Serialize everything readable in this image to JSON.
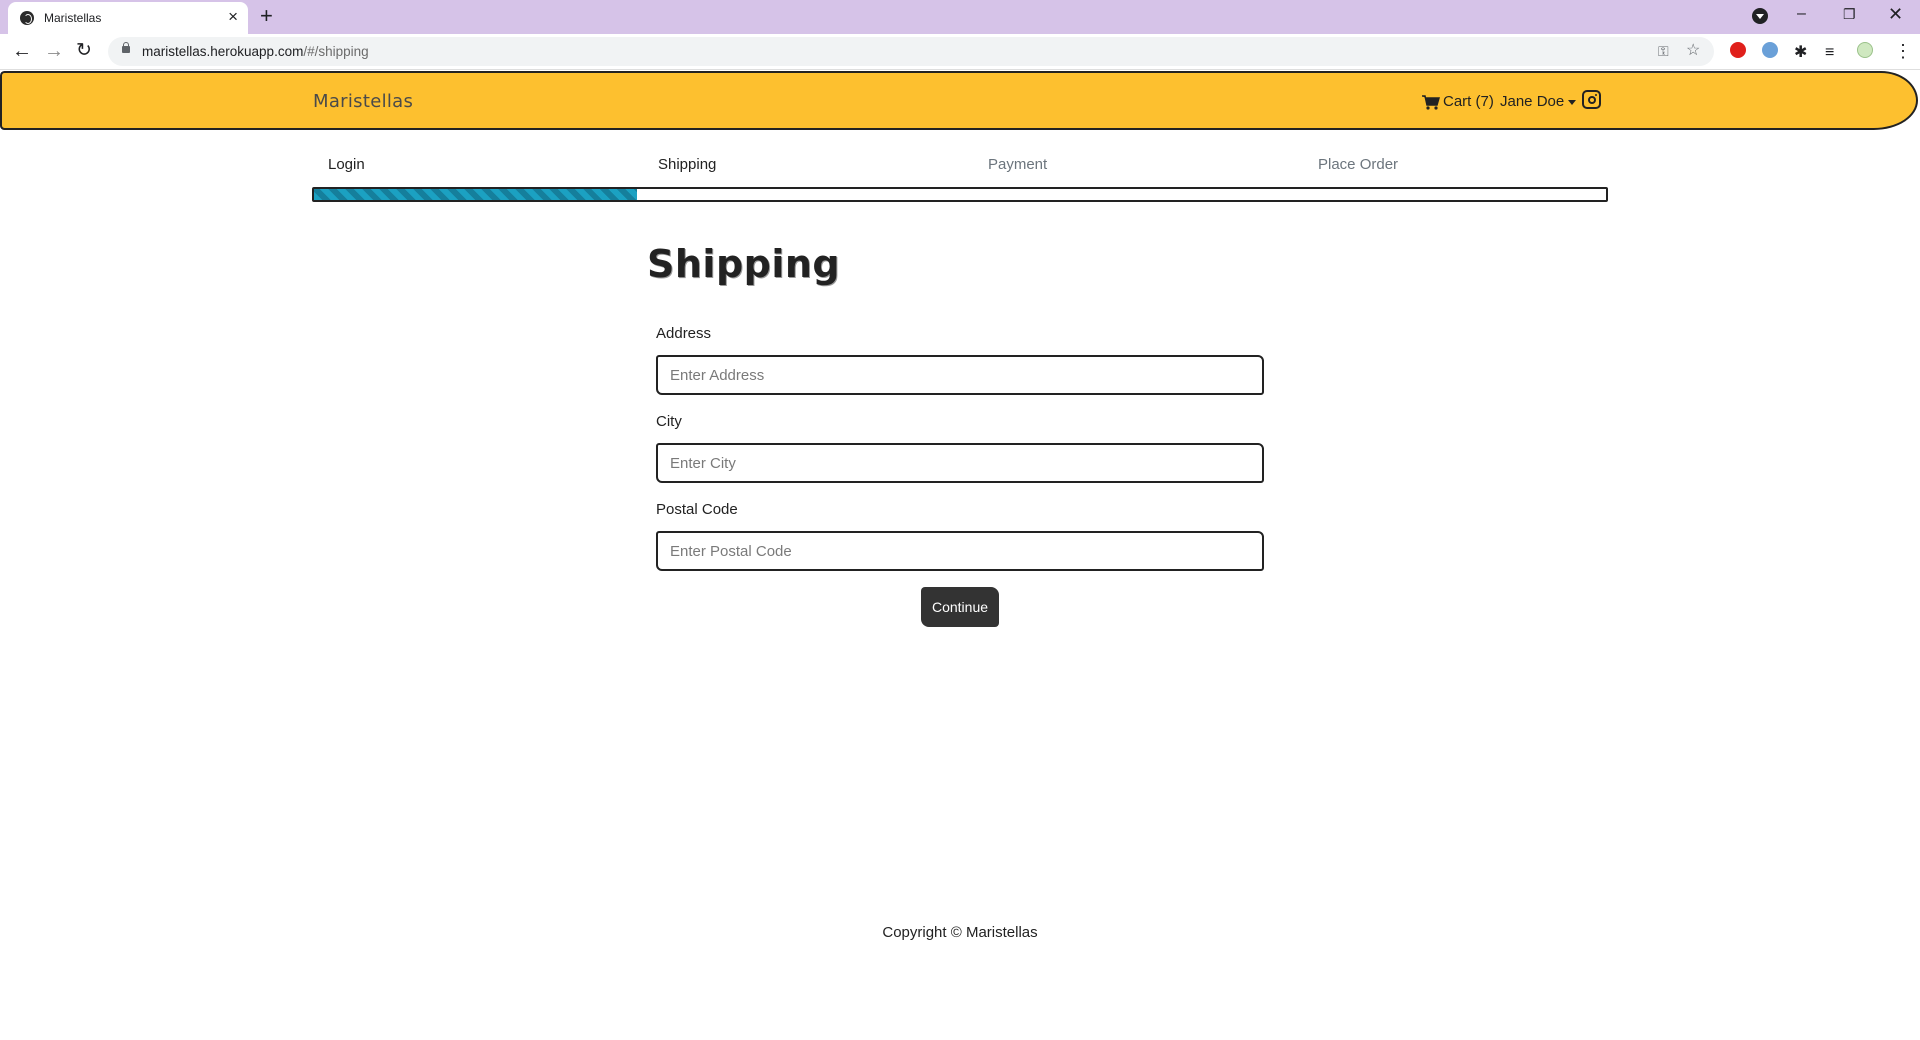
{
  "browser": {
    "tab_title": "Maristellas",
    "url_host": "maristellas.herokuapp.com",
    "url_path": "/#/shipping"
  },
  "navbar": {
    "brand": "Maristellas",
    "cart_label": "Cart (7)",
    "user_name": "Jane Doe"
  },
  "steps": [
    {
      "label": "Login",
      "active": true
    },
    {
      "label": "Shipping",
      "active": true
    },
    {
      "label": "Payment",
      "active": false
    },
    {
      "label": "Place Order",
      "active": false
    }
  ],
  "progress": {
    "percent": 25
  },
  "page": {
    "title": "Shipping"
  },
  "form": {
    "address": {
      "label": "Address",
      "placeholder": "Enter Address",
      "value": ""
    },
    "city": {
      "label": "City",
      "placeholder": "Enter City",
      "value": ""
    },
    "postal_code": {
      "label": "Postal Code",
      "placeholder": "Enter Postal Code",
      "value": ""
    },
    "submit_label": "Continue"
  },
  "footer": {
    "copyright": "Copyright © Maristellas"
  },
  "colors": {
    "navbar_bg": "#fdc02f",
    "progress_fill": "#1ba1c2",
    "tabbar_bg": "#d6c3e8",
    "button_bg": "#333333"
  }
}
